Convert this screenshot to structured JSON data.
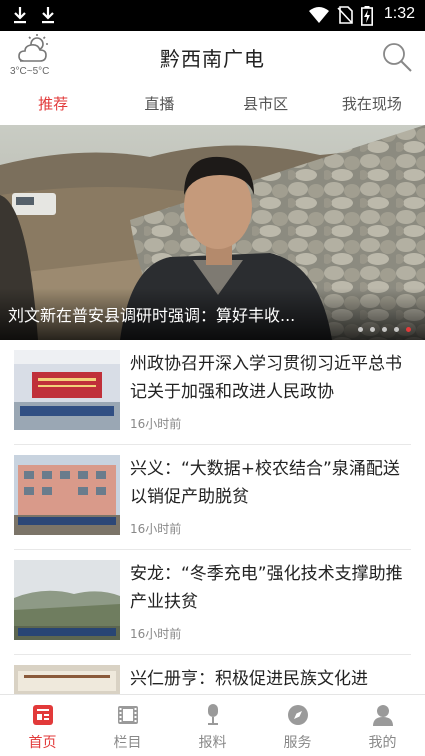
{
  "status_bar": {
    "time": "1:32",
    "icons": [
      "download-icon",
      "download-icon",
      "wifi-icon",
      "no-sim-icon",
      "battery-charging-icon"
    ]
  },
  "header": {
    "weather_icon": "cloudy-sun-icon",
    "temperature": "3°C~5°C",
    "title": "黔西南广电",
    "search_icon": "search-icon"
  },
  "tabs": [
    {
      "label": "推荐",
      "active": true
    },
    {
      "label": "直播",
      "active": false
    },
    {
      "label": "县市区",
      "active": false
    },
    {
      "label": "我在现场",
      "active": false
    }
  ],
  "banner": {
    "caption": "刘文新在普安县调研时强调：算好丰收...",
    "slide_count": 5,
    "active_slide": 5
  },
  "news": [
    {
      "title": "州政协召开深入学习贯彻习近平总书记关于加强和改进人民政协",
      "time": "16小时前"
    },
    {
      "title": "兴义：“大数据+校农结合”泉涌配送以销促产助脱贫",
      "time": "16小时前"
    },
    {
      "title": "安龙：“冬季充电”强化技术支撑助推产业扶贫",
      "time": "16小时前"
    },
    {
      "title": "兴仁册亨：积极促进民族文化进",
      "time": ""
    }
  ],
  "bottom_nav": [
    {
      "label": "首页",
      "icon": "home-news-icon",
      "active": true
    },
    {
      "label": "栏目",
      "icon": "film-icon",
      "active": false
    },
    {
      "label": "报料",
      "icon": "microphone-icon",
      "active": false
    },
    {
      "label": "服务",
      "icon": "compass-icon",
      "active": false
    },
    {
      "label": "我的",
      "icon": "user-icon",
      "active": false
    }
  ],
  "colors": {
    "accent": "#e23a3a",
    "text": "#222222",
    "muted": "#888888"
  }
}
